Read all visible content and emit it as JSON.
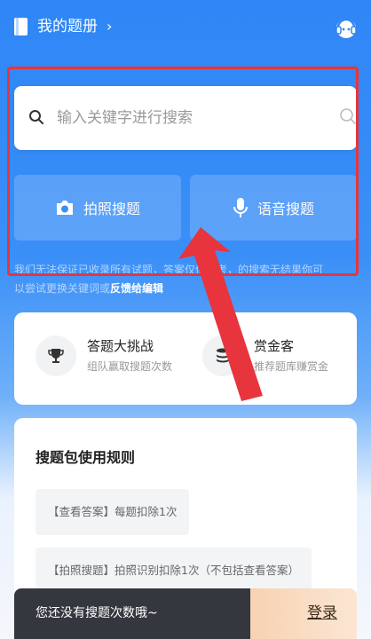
{
  "header": {
    "title": "我的题册"
  },
  "search": {
    "placeholder": "输入关键字进行搜索"
  },
  "actions": {
    "photo_label": "拍照搜题",
    "voice_label": "语音搜题"
  },
  "notice": {
    "line1": "我们无法保证已收录所有试题，答案仅供参考，的搜索无结果你可",
    "line2": "以尝试更换关键词或",
    "feedback_link": "反馈给编辑"
  },
  "features": [
    {
      "title": "答题大挑战",
      "subtitle": "组队赢取搜题次数"
    },
    {
      "title": "赏金客",
      "subtitle": "推荐题库赚赏金"
    }
  ],
  "rules": {
    "title": "搜题包使用规则",
    "items": [
      "【查看答案】每题扣除1次",
      "【拍照搜题】拍照识别扣除1次（不包括查看答案）"
    ]
  },
  "bottom": {
    "message": "您还没有搜题次数哦~",
    "login_label": "登录"
  },
  "colors": {
    "accent_blue": "#2f86f6",
    "annotation_red": "#e8343c"
  }
}
